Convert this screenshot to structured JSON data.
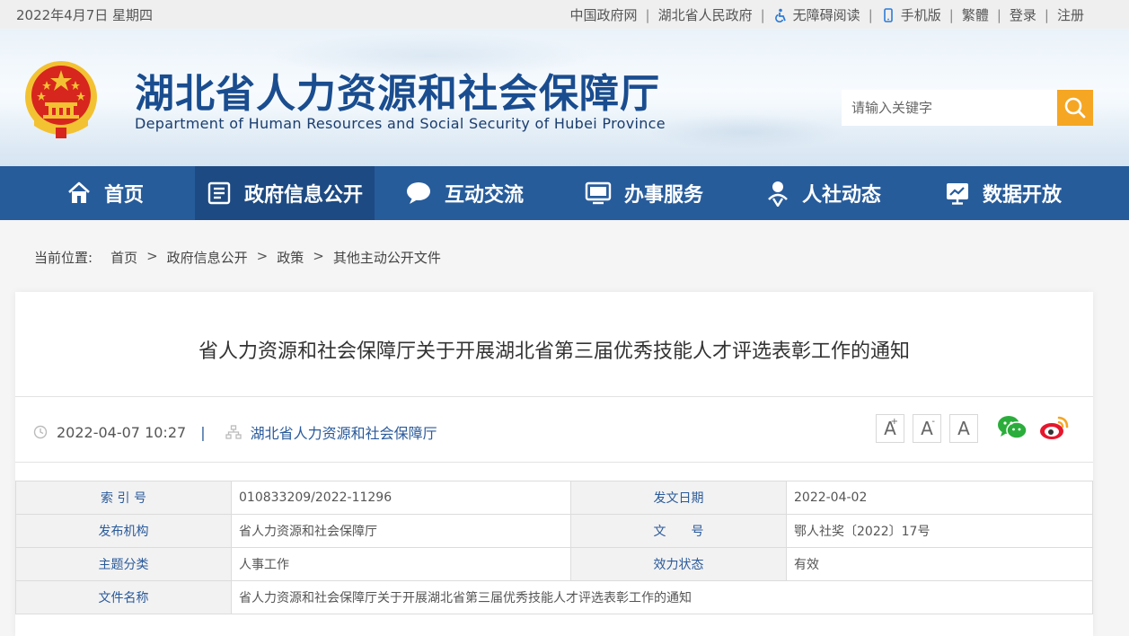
{
  "topbar": {
    "date": "2022年4月7日 星期四",
    "links": [
      "中国政府网",
      "湖北省人民政府",
      "无障碍阅读",
      "手机版",
      "繁體",
      "登录",
      "注册"
    ]
  },
  "header": {
    "title": "湖北省人力资源和社会保障厅",
    "subtitle": "Department of Human Resources and Social Security of Hubei Province",
    "search_placeholder": "请输入关键字"
  },
  "nav": [
    {
      "label": "首页",
      "icon": "home-icon"
    },
    {
      "label": "政府信息公开",
      "icon": "document-list-icon"
    },
    {
      "label": "互动交流",
      "icon": "chat-bubble-icon"
    },
    {
      "label": "办事服务",
      "icon": "monitor-icon"
    },
    {
      "label": "人社动态",
      "icon": "person-badge-icon"
    },
    {
      "label": "数据开放",
      "icon": "chart-screen-icon"
    }
  ],
  "breadcrumb": {
    "label": "当前位置:",
    "items": [
      "首页",
      "政府信息公开",
      "政策",
      "其他主动公开文件"
    ]
  },
  "article": {
    "title": "省人力资源和社会保障厅关于开展湖北省第三届优秀技能人才评选表彰工作的通知",
    "datetime": "2022-04-07 10:27",
    "publisher": "湖北省人力资源和社会保障厅",
    "font_larger": "A",
    "font_smaller": "A",
    "font_reset": "A",
    "font_larger_mark": "+",
    "font_smaller_mark": "-"
  },
  "info": {
    "rows": [
      {
        "k1": "索 引 号",
        "v1": "010833209/2022-11296",
        "k2": "发文日期",
        "v2": "2022-04-02"
      },
      {
        "k1": "发布机构",
        "v1": "省人力资源和社会保障厅",
        "k2": "文　　号",
        "v2": "鄂人社奖〔2022〕17号"
      },
      {
        "k1": "主题分类",
        "v1": "人事工作",
        "k2": "效力状态",
        "v2": "有效"
      }
    ],
    "filename_label": "文件名称",
    "filename": "省人力资源和社会保障厅关于开展湖北省第三届优秀技能人才评选表彰工作的通知"
  },
  "colors": {
    "nav_bg": "#275c9b",
    "nav_active": "#1d4a82",
    "title_blue": "#1a4d8f",
    "search_btn": "#f5a623",
    "emblem_red": "#d7261e",
    "emblem_gold": "#f3c233"
  }
}
